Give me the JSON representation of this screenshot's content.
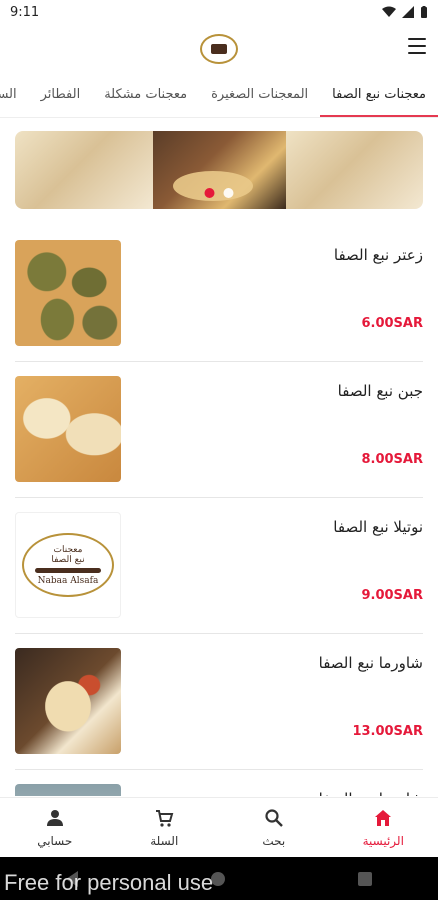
{
  "status": {
    "time": "9:11"
  },
  "tabs": [
    {
      "label": "معجنات نبع الصفا",
      "active": true
    },
    {
      "label": "المعجنات الصغيرة",
      "active": false
    },
    {
      "label": "معجنات مشكلة",
      "active": false
    },
    {
      "label": "الفطائر",
      "active": false
    },
    {
      "label": "السد",
      "active": false
    }
  ],
  "products": [
    {
      "name": "زعتر نبع الصفا",
      "price": "6.00SAR",
      "image": "zaatar"
    },
    {
      "name": "جبن نبع الصفا",
      "price": "8.00SAR",
      "image": "cheese"
    },
    {
      "name": "نوتيلا نبع الصفا",
      "price": "9.00SAR",
      "image": "nutella"
    },
    {
      "name": "شاورما نبع الصفا",
      "price": "13.00SAR",
      "image": "shawarma"
    },
    {
      "name": "شاورما نبع الصفا",
      "price": "",
      "image": "fifth"
    }
  ],
  "mini_logo": {
    "line1": "معجنات",
    "line2": "نبع الصفا",
    "line3": "Nabaa Alsafa"
  },
  "bottom_nav": [
    {
      "label": "الرئيسية",
      "icon": "home-icon",
      "active": true
    },
    {
      "label": "بحث",
      "icon": "search-icon",
      "active": false
    },
    {
      "label": "السلة",
      "icon": "cart-icon",
      "active": false
    },
    {
      "label": "حسابي",
      "icon": "account-icon",
      "active": false
    }
  ],
  "watermark": "Free for personal use",
  "colors": {
    "accent": "#e5193a",
    "brand_gold": "#b8923a"
  }
}
